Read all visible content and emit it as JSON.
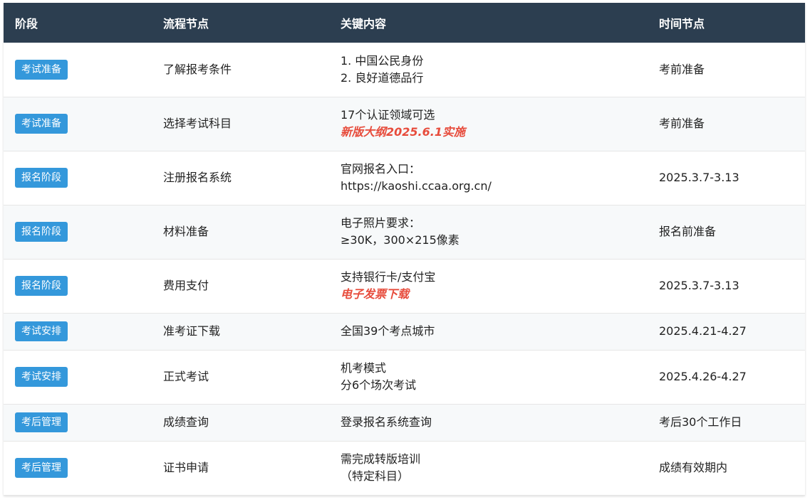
{
  "headers": [
    "阶段",
    "流程节点",
    "关键内容",
    "时间节点"
  ],
  "colors": {
    "header_bg": "#2c3e50",
    "badge_bg": "#3498db",
    "highlight": "#e74c3c"
  },
  "rows": [
    {
      "stage": "考试准备",
      "node": "了解报考条件",
      "line1": "1. 中国公民身份",
      "line2": "2. 良好道德品行",
      "highlight": "",
      "time": "考前准备"
    },
    {
      "stage": "考试准备",
      "node": "选择考试科目",
      "line1": "17个认证领域可选",
      "line2": "",
      "highlight": "新版大纲2025.6.1实施",
      "time": "考前准备"
    },
    {
      "stage": "报名阶段",
      "node": "注册报名系统",
      "line1": "官网报名入口：",
      "line2": "https://kaoshi.ccaa.org.cn/",
      "highlight": "",
      "time": "2025.3.7-3.13"
    },
    {
      "stage": "报名阶段",
      "node": "材料准备",
      "line1": "电子照片要求：",
      "line2": "≥30K，300×215像素",
      "highlight": "",
      "time": "报名前准备"
    },
    {
      "stage": "报名阶段",
      "node": "费用支付",
      "line1": "支持银行卡/支付宝",
      "line2": "",
      "highlight": "电子发票下载",
      "time": "2025.3.7-3.13"
    },
    {
      "stage": "考试安排",
      "node": "准考证下载",
      "line1": "全国39个考点城市",
      "line2": "",
      "highlight": "",
      "time": "2025.4.21-4.27"
    },
    {
      "stage": "考试安排",
      "node": "正式考试",
      "line1": "机考模式",
      "line2": "分6个场次考试",
      "highlight": "",
      "time": "2025.4.26-4.27"
    },
    {
      "stage": "考后管理",
      "node": "成绩查询",
      "line1": "登录报名系统查询",
      "line2": "",
      "highlight": "",
      "time": "考后30个工作日"
    },
    {
      "stage": "考后管理",
      "node": "证书申请",
      "line1": "需完成转版培训",
      "line2": "（特定科目）",
      "highlight": "",
      "time": "成绩有效期内"
    }
  ]
}
